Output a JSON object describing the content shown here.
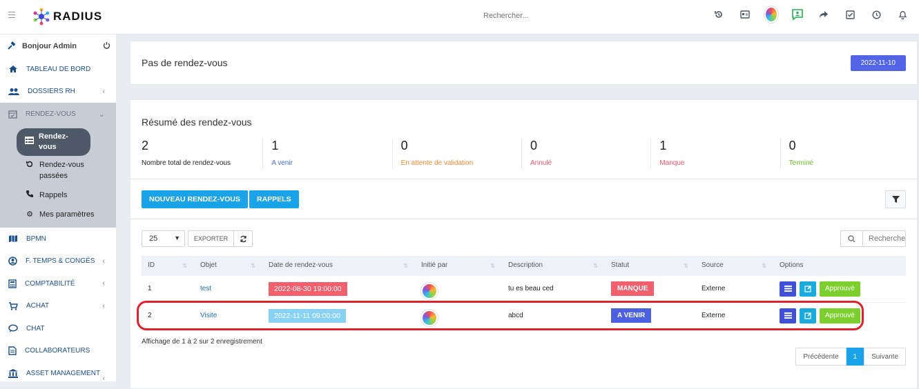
{
  "brand": {
    "name": "RADIUS"
  },
  "top": {
    "search_placeholder": "Rechercher..."
  },
  "sidebar": {
    "greeting": "Bonjour Admin",
    "items": [
      {
        "label": "TABLEAU DE BORD"
      },
      {
        "label": "DOSSIERS RH"
      },
      {
        "label": "RENDEZ-VOUS"
      },
      {
        "label": "BPMN"
      },
      {
        "label": "F. TEMPS & CONGÉS"
      },
      {
        "label": "COMPTABILITÉ"
      },
      {
        "label": "ACHAT"
      },
      {
        "label": "CHAT"
      },
      {
        "label": "COLLABORATEURS"
      },
      {
        "label": "ASSET MANAGEMENT"
      }
    ],
    "sub": [
      {
        "label": "Rendez-vous"
      },
      {
        "label": "Rendez-vous passées"
      },
      {
        "label": "Rappels"
      },
      {
        "label": "Mes paramètres"
      }
    ]
  },
  "header": {
    "title": "Pas de rendez-vous",
    "date": "2022-11-10"
  },
  "summary": {
    "title": "Résumé des rendez-vous",
    "stats": [
      {
        "value": "2",
        "label": "Nombre total de rendez-vous",
        "color": "#222222"
      },
      {
        "value": "1",
        "label": "A venir",
        "color": "#3b6fd8"
      },
      {
        "value": "0",
        "label": "En attente de validation",
        "color": "#f0883a"
      },
      {
        "value": "0",
        "label": "Annulé",
        "color": "#f05a6a"
      },
      {
        "value": "1",
        "label": "Manque",
        "color": "#f05a6a"
      },
      {
        "value": "0",
        "label": "Terminé",
        "color": "#6cc02e"
      }
    ]
  },
  "actions": {
    "new": "NOUVEAU RENDEZ-VOUS",
    "reminders": "RAPPELS"
  },
  "table_controls": {
    "page_size": "25",
    "export": "EXPORTER",
    "search_placeholder": "Rechercher"
  },
  "table": {
    "headers": [
      "ID",
      "Objet",
      "Date de rendez-vous",
      "Initié par",
      "Description",
      "Statut",
      "Source",
      "Options"
    ],
    "rows": [
      {
        "id": "1",
        "object": "test",
        "date": "2022-08-30 19:00:00",
        "description": "tu es beau ced",
        "status": "MANQUE",
        "source": "Externe",
        "approve": "Approuvé"
      },
      {
        "id": "2",
        "object": "Visite",
        "date": "2022-11-11 09:00:00",
        "description": "abcd",
        "status": "A VENIR",
        "source": "Externe",
        "approve": "Approuvé"
      }
    ]
  },
  "footer": {
    "info": "Affichage de 1 à 2 sur 2 enregistrement",
    "prev": "Précédente",
    "page": "1",
    "next": "Suivante"
  }
}
